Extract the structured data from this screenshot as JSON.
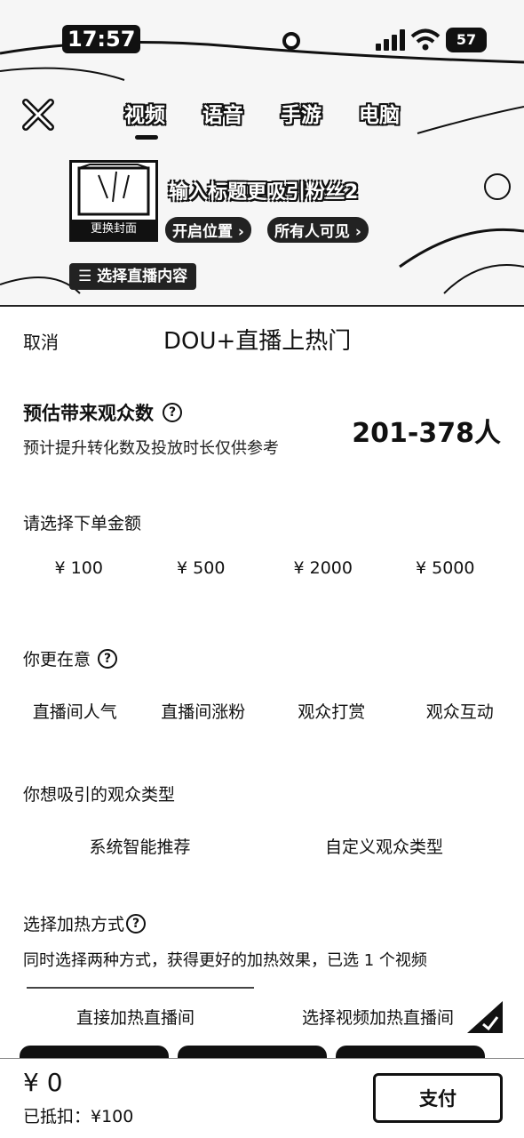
{
  "status_bar": {
    "time": "17:57",
    "battery": "57"
  },
  "mode_tabs": [
    {
      "label": "视频",
      "active": true
    },
    {
      "label": "语音",
      "active": false
    },
    {
      "label": "手游",
      "active": false
    },
    {
      "label": "电脑",
      "active": false
    }
  ],
  "preview": {
    "cover_label": "更换封面",
    "title_placeholder": "输入标题更吸引粉丝2",
    "location_chip": "开启位置 ›",
    "visibility_chip": "所有人可见 ›",
    "content_select": "☰ 选择直播内容"
  },
  "sheet": {
    "cancel": "取消",
    "title": "DOU+直播上热门",
    "estimate": {
      "title": "预估带来观众数",
      "subtitle": "预计提升转化数及投放时长仅供参考",
      "value": "201-378人"
    },
    "amount": {
      "label": "请选择下单金额",
      "options": [
        "¥ 100",
        "¥ 500",
        "¥ 2000",
        "¥ 5000"
      ]
    },
    "goal": {
      "label": "你更在意",
      "options": [
        "直播间人气",
        "直播间涨粉",
        "观众打赏",
        "观众互动"
      ]
    },
    "audience": {
      "label": "你想吸引的观众类型",
      "options": [
        "系统智能推荐",
        "自定义观众类型"
      ]
    },
    "method": {
      "label": "选择加热方式",
      "description": "同时选择两种方式，获得更好的加热效果，已选 1 个视频",
      "tabs": [
        "直接加热直播间",
        "选择视频加热直播间"
      ]
    }
  },
  "footer": {
    "total": "¥ 0",
    "offset": "已抵扣：¥100",
    "pay": "支付"
  }
}
